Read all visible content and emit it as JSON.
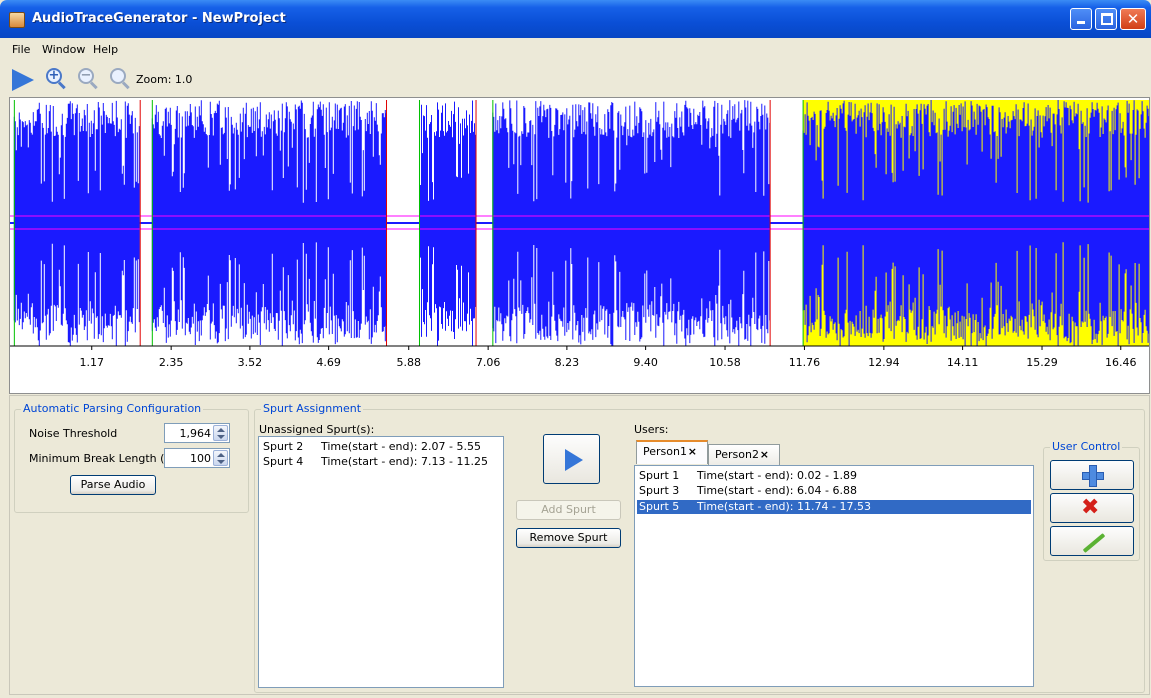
{
  "window": {
    "title": "AudioTraceGenerator - NewProject"
  },
  "menu": {
    "items": [
      "File",
      "Window",
      "Help"
    ]
  },
  "toolbar": {
    "zoom_label": "Zoom: 1.0"
  },
  "waveform": {
    "ticks": [
      "1.17",
      "2.35",
      "3.52",
      "4.69",
      "5.88",
      "7.06",
      "8.23",
      "9.40",
      "10.58",
      "11.76",
      "12.94",
      "14.11",
      "15.29",
      "16.46"
    ],
    "colors": {
      "wave": "#1a1aff",
      "selection": "#ffff00",
      "start_marker": "#00c000",
      "end_marker": "#e00000",
      "threshold": "#ff00ff"
    },
    "segments": [
      {
        "start": 0.02,
        "end": 1.89
      },
      {
        "start": 2.07,
        "end": 5.55
      },
      {
        "start": 6.04,
        "end": 6.88
      },
      {
        "start": 7.13,
        "end": 11.25
      },
      {
        "start": 11.74,
        "end": 17.53,
        "selected": true
      }
    ]
  },
  "parsing": {
    "title": "Automatic Parsing Configuration",
    "noise_label": "Noise Threshold",
    "noise_value": "1,964",
    "break_label": "Minimum Break Length (ms)",
    "break_value": "100",
    "parse_button": "Parse Audio"
  },
  "spurts": {
    "title": "Spurt Assignment",
    "unassigned_label": "Unassigned Spurt(s):",
    "unassigned": [
      {
        "name": "Spurt 2",
        "time": "Time(start - end): 2.07 - 5.55"
      },
      {
        "name": "Spurt 4",
        "time": "Time(start - end): 7.13 - 11.25"
      }
    ],
    "add_button": "Add Spurt",
    "remove_button": "Remove Spurt",
    "users_label": "Users:",
    "tabs": [
      "Person1",
      "Person2"
    ],
    "assigned": [
      {
        "name": "Spurt 1",
        "time": "Time(start - end): 0.02 - 1.89"
      },
      {
        "name": "Spurt 3",
        "time": "Time(start - end): 6.04 - 6.88"
      },
      {
        "name": "Spurt 5",
        "time": "Time(start - end): 11.74 - 17.53",
        "selected": true
      }
    ]
  },
  "user_control": {
    "title": "User Control"
  }
}
